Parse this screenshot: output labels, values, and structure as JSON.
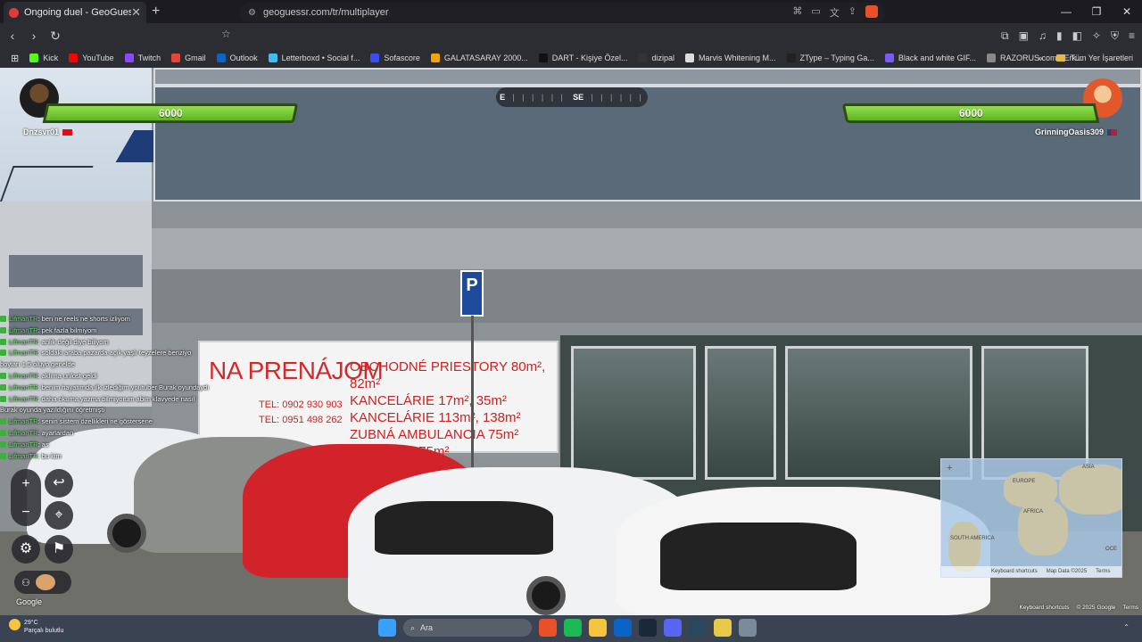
{
  "browser": {
    "tab_title": "Ongoing duel - GeoGuessr",
    "new_tab": "+",
    "window_controls": {
      "minimize": "—",
      "restore": "❐",
      "close": "✕"
    },
    "url": "geoguessr.com/tr/multiplayer",
    "bookmarks": [
      {
        "label": "Kick",
        "color": "#53fc18"
      },
      {
        "label": "YouTube",
        "color": "#ff0000"
      },
      {
        "label": "Twitch",
        "color": "#9146ff"
      },
      {
        "label": "Gmail",
        "color": "#ea4335"
      },
      {
        "label": "Outlook",
        "color": "#0a64c8"
      },
      {
        "label": "Letterboxd • Social f...",
        "color": "#40bcf4"
      },
      {
        "label": "Sofascore",
        "color": "#374df5"
      },
      {
        "label": "GALATASARAY 2000...",
        "color": "#f4a300"
      },
      {
        "label": "DART - Kişiye Özel...",
        "color": "#111111"
      },
      {
        "label": "dizipal",
        "color": "#333333"
      },
      {
        "label": "Marvis Whitening M...",
        "color": "#dddddd"
      },
      {
        "label": "ZType – Typing Ga...",
        "color": "#222222"
      },
      {
        "label": "Black and white GIF...",
        "color": "#7a5af8"
      },
      {
        "label": "RAZORUS.com - Erk...",
        "color": "#888888"
      }
    ],
    "bookmarks_more": "»",
    "all_bookmarks": "Tüm Yer İşaretleri"
  },
  "game": {
    "left_player": {
      "name": "Dnzsvr01",
      "health": "6000",
      "flag_colors": [
        "#e30a17",
        "#ffffff"
      ]
    },
    "right_player": {
      "name": "GrinningOasis309",
      "health": "6000",
      "flag_colors": [
        "#b22234",
        "#3c3b6e"
      ]
    },
    "compass": {
      "left": "E",
      "right": "SE",
      "ticks": "| | | | | |"
    },
    "chat": [
      {
        "user": "LifmanTR",
        "text": ": ben ne reels ne shorts izliyom"
      },
      {
        "user": "LifmanTR",
        "text": ": pek fazla bilmiyom"
      },
      {
        "user": "LifmanTR",
        "text": ": anlık değil diye biliyom"
      },
      {
        "user": "LifmanTR",
        "text": ": soldaki araba pazarda açık yaşlı teyzelere benziyo boyları 1.5 oluyo genelde"
      },
      {
        "user": "LifmanTR",
        "text": ": aklıma unlost geldi"
      },
      {
        "user": "LifmanTR",
        "text": ": benim hayatımda ilk izlediğim youtuber Burak oyundaydı"
      },
      {
        "user": "LifmanTR",
        "text": ": daha okuma yazma bilmiyorum abim klavyede nasıl Burak oyunda yazıldığını öğretmişti"
      },
      {
        "user": "LifmanTR",
        "text": ": senin sistem özellikleri ne göstersene"
      },
      {
        "user": "LifmanTR",
        "text": ": ayarlardan"
      },
      {
        "user": "LifmanTR",
        "text": ": as"
      },
      {
        "user": "LifmanTR",
        "text": ": bu kim"
      }
    ],
    "controls": {
      "zoom_in": "+",
      "zoom_out": "−",
      "undo": "↩",
      "pin": "⌖",
      "settings": "⚙",
      "flag": "⚑",
      "party": "⚇"
    },
    "google_label": "Google",
    "minimap": {
      "zoom": "+",
      "labels": [
        "EUROPE",
        "AFRICA",
        "ASIA",
        "SOUTH AMERICA",
        "OCE"
      ],
      "footer": [
        "Keyboard shortcuts",
        "Map Data ©2025",
        "Terms"
      ]
    },
    "streetview_footer": [
      "Keyboard shortcuts",
      "© 2025 Google",
      "Terms"
    ]
  },
  "scene": {
    "sign_title": "NA PRENÁJOM",
    "sign_lines": [
      "OBCHODNÉ PRIESTORY 80m², 82m²",
      "KANCELÁRIE 17m², 35m²",
      "KANCELÁRIE 113m², 138m²",
      "ZUBNÁ AMBULANCIA 75m²",
      "MEZONET 75m²"
    ],
    "phone_lines": [
      "TEL: 0902 930 903",
      "TEL: 0951 498 262"
    ],
    "parking_sign": "P"
  },
  "taskbar": {
    "weather_temp": "29°C",
    "weather_desc": "Parçalı bulutlu",
    "search_placeholder": "Ara",
    "apps": [
      {
        "name": "windows-start",
        "color": "#3aa0ff"
      },
      {
        "name": "brave",
        "color": "#e8502a"
      },
      {
        "name": "spotify",
        "color": "#1db954"
      },
      {
        "name": "file-explorer",
        "color": "#f5c542"
      },
      {
        "name": "outlook",
        "color": "#0a64c8"
      },
      {
        "name": "steam",
        "color": "#1b2838"
      },
      {
        "name": "discord",
        "color": "#5865f2"
      },
      {
        "name": "steam-2",
        "color": "#2a475e"
      },
      {
        "name": "app-yellow",
        "color": "#e6c84a"
      },
      {
        "name": "settings",
        "color": "#7a8a9a"
      }
    ]
  }
}
